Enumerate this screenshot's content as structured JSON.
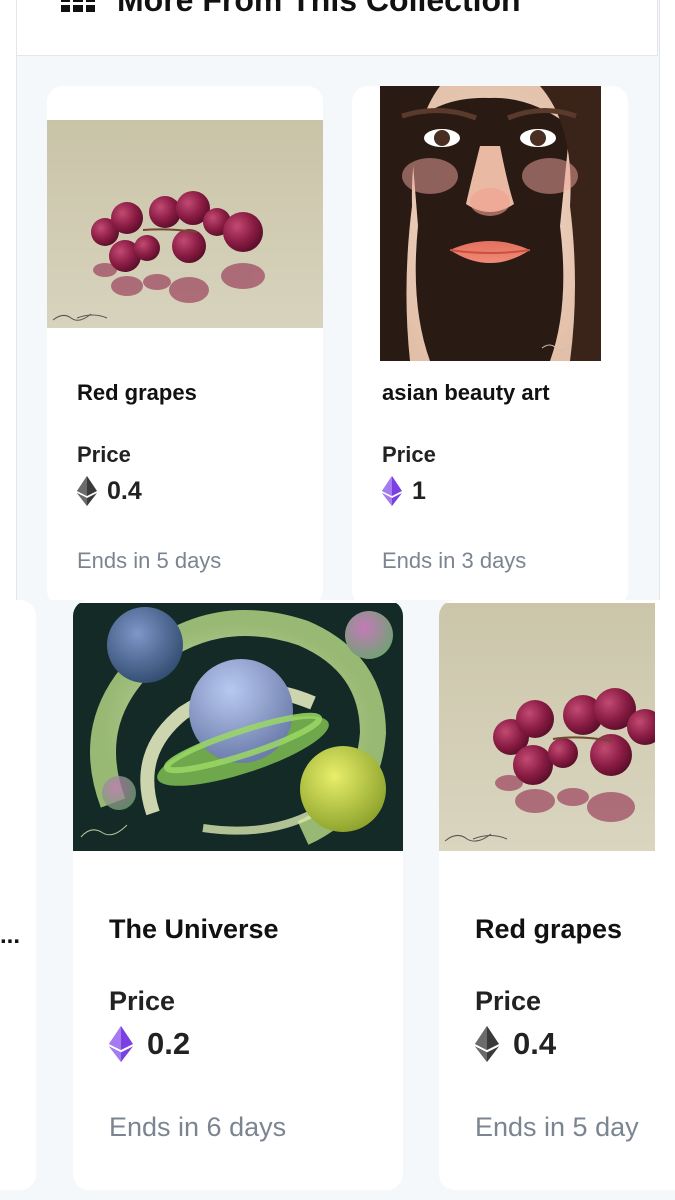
{
  "header": {
    "title": "More From This Collection"
  },
  "colors": {
    "eth_black": "#3a3a3a",
    "eth_purple": "#7b3fe4",
    "muted_text": "#7b8591",
    "panel_bg": "#f5f8fa"
  },
  "top_cards": [
    {
      "name": "Red grapes",
      "price_label": "Price",
      "price": "0.4",
      "currency_icon": "eth-black-icon",
      "ends": "Ends in 5 days"
    },
    {
      "name": "asian beauty art",
      "price_label": "Price",
      "price": "1",
      "currency_icon": "eth-purple-icon",
      "ends": "Ends in 3 days"
    }
  ],
  "bottom": {
    "ellipsis": "..."
  },
  "bottom_cards": [
    {
      "name": "The Universe",
      "price_label": "Price",
      "price": "0.2",
      "currency_icon": "eth-purple-icon",
      "ends": "Ends in 6 days"
    },
    {
      "name": "Red grapes",
      "price_label": "Price",
      "price": "0.4",
      "currency_icon": "eth-black-icon",
      "ends": "Ends in 5 day"
    }
  ]
}
